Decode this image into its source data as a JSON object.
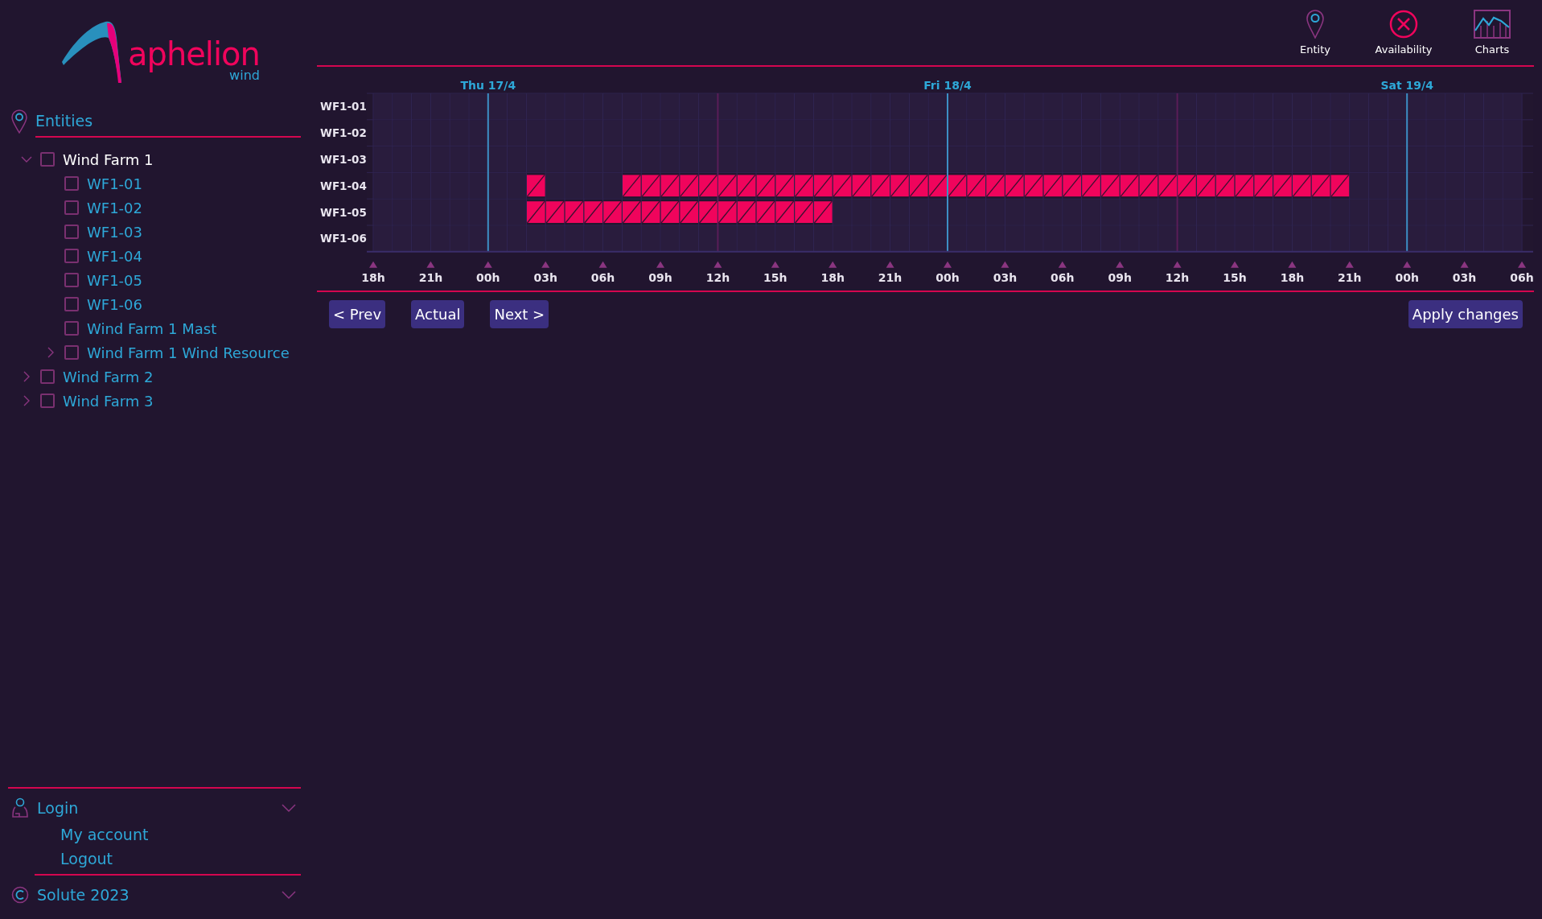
{
  "logo": {
    "name": "aphelion",
    "tagline": "wind"
  },
  "sidebar": {
    "section_title": "Entities",
    "tree": [
      {
        "kind": "group",
        "label": "Wind Farm 1",
        "checked": false,
        "selected": true,
        "expanded": true,
        "children": [
          {
            "kind": "leaf",
            "label": "WF1-01",
            "checked": false,
            "selected": false
          },
          {
            "kind": "leaf",
            "label": "WF1-02",
            "checked": false,
            "selected": false
          },
          {
            "kind": "leaf",
            "label": "WF1-03",
            "checked": false,
            "selected": false
          },
          {
            "kind": "leaf",
            "label": "WF1-04",
            "checked": false,
            "selected": false
          },
          {
            "kind": "leaf",
            "label": "WF1-05",
            "checked": false,
            "selected": false
          },
          {
            "kind": "leaf",
            "label": "WF1-06",
            "checked": false,
            "selected": false
          },
          {
            "kind": "leaf",
            "label": "Wind Farm 1 Mast",
            "checked": false,
            "selected": false
          },
          {
            "kind": "group",
            "label": "Wind Farm 1 Wind Resource",
            "checked": false,
            "selected": false,
            "expanded": false
          }
        ]
      },
      {
        "kind": "group",
        "label": "Wind Farm 2",
        "checked": false,
        "selected": false,
        "expanded": false
      },
      {
        "kind": "group",
        "label": "Wind Farm 3",
        "checked": false,
        "selected": false,
        "expanded": false
      }
    ],
    "login": {
      "title": "Login",
      "items": [
        "My account",
        "Logout"
      ]
    },
    "footer": "Solute 2023"
  },
  "top_nav": [
    {
      "kind": "pin",
      "label": "Entity"
    },
    {
      "kind": "cross",
      "label": "Availability"
    },
    {
      "kind": "chart",
      "label": "Charts"
    }
  ],
  "availability_grid": {
    "rows": [
      {
        "label": "WF1-01",
        "unavailable": [
          false,
          false,
          false,
          false,
          false,
          false,
          false,
          false,
          false,
          false,
          false,
          false,
          false,
          false,
          false,
          false,
          false,
          false,
          false,
          false,
          false,
          false,
          false,
          false,
          false,
          false,
          false,
          false,
          false,
          false,
          false,
          false,
          false,
          false,
          false,
          false,
          false,
          false,
          false,
          false,
          false,
          false,
          false,
          false,
          false,
          false,
          false,
          false,
          false,
          false,
          false,
          false,
          false,
          false,
          false,
          false,
          false,
          false,
          false,
          false
        ]
      },
      {
        "label": "WF1-02",
        "unavailable": [
          false,
          false,
          false,
          false,
          false,
          false,
          false,
          false,
          false,
          false,
          false,
          false,
          false,
          false,
          false,
          false,
          false,
          false,
          false,
          false,
          false,
          false,
          false,
          false,
          false,
          false,
          false,
          false,
          false,
          false,
          false,
          false,
          false,
          false,
          false,
          false,
          false,
          false,
          false,
          false,
          false,
          false,
          false,
          false,
          false,
          false,
          false,
          false,
          false,
          false,
          false,
          false,
          false,
          false,
          false,
          false,
          false,
          false,
          false,
          false
        ]
      },
      {
        "label": "WF1-03",
        "unavailable": [
          false,
          false,
          false,
          false,
          false,
          false,
          false,
          false,
          false,
          false,
          false,
          false,
          false,
          false,
          false,
          false,
          false,
          false,
          false,
          false,
          false,
          false,
          false,
          false,
          false,
          false,
          false,
          false,
          false,
          false,
          false,
          false,
          false,
          false,
          false,
          false,
          false,
          false,
          false,
          false,
          false,
          false,
          false,
          false,
          false,
          false,
          false,
          false,
          false,
          false,
          false,
          false,
          false,
          false,
          false,
          false,
          false,
          false,
          false,
          false
        ]
      },
      {
        "label": "WF1-04",
        "unavailable": [
          false,
          false,
          false,
          false,
          false,
          false,
          false,
          false,
          true,
          false,
          false,
          false,
          false,
          true,
          true,
          true,
          true,
          true,
          true,
          true,
          true,
          true,
          true,
          true,
          true,
          true,
          true,
          true,
          true,
          true,
          true,
          true,
          true,
          true,
          true,
          true,
          true,
          true,
          true,
          true,
          true,
          true,
          true,
          true,
          true,
          true,
          true,
          true,
          true,
          true,
          true,
          false,
          false,
          false,
          false,
          false,
          false,
          false,
          false,
          false
        ]
      },
      {
        "label": "WF1-05",
        "unavailable": [
          false,
          false,
          false,
          false,
          false,
          false,
          false,
          false,
          true,
          true,
          true,
          true,
          true,
          true,
          true,
          true,
          true,
          true,
          true,
          true,
          true,
          true,
          true,
          true,
          false,
          false,
          false,
          false,
          false,
          false,
          false,
          false,
          false,
          false,
          false,
          false,
          false,
          false,
          false,
          false,
          false,
          false,
          false,
          false,
          false,
          false,
          false,
          false,
          false,
          false,
          false,
          false,
          false,
          false,
          false,
          false,
          false,
          false,
          false,
          false
        ]
      },
      {
        "label": "WF1-06",
        "unavailable": [
          false,
          false,
          false,
          false,
          false,
          false,
          false,
          false,
          false,
          false,
          false,
          false,
          false,
          false,
          false,
          false,
          false,
          false,
          false,
          false,
          false,
          false,
          false,
          false,
          false,
          false,
          false,
          false,
          false,
          false,
          false,
          false,
          false,
          false,
          false,
          false,
          false,
          false,
          false,
          false,
          false,
          false,
          false,
          false,
          false,
          false,
          false,
          false,
          false,
          false,
          false,
          false,
          false,
          false,
          false,
          false,
          false,
          false,
          false,
          false
        ]
      }
    ],
    "ticks": [
      {
        "label": "18h"
      },
      {
        "label": "21h"
      },
      {
        "label": "00h",
        "day": "Thu 17/4"
      },
      {
        "label": "03h"
      },
      {
        "label": "06h"
      },
      {
        "label": "09h"
      },
      {
        "label": "12h"
      },
      {
        "label": "15h"
      },
      {
        "label": "18h"
      },
      {
        "label": "21h"
      },
      {
        "label": "00h",
        "day": "Fri 18/4"
      },
      {
        "label": "03h"
      },
      {
        "label": "06h"
      },
      {
        "label": "09h"
      },
      {
        "label": "12h"
      },
      {
        "label": "15h"
      },
      {
        "label": "18h"
      },
      {
        "label": "21h"
      },
      {
        "label": "00h",
        "day": "Sat 19/4"
      },
      {
        "label": "03h"
      },
      {
        "label": "06h"
      }
    ]
  },
  "buttons": {
    "left": [
      "< Prev",
      "Actual",
      "Next >"
    ],
    "right": "Apply changes"
  }
}
